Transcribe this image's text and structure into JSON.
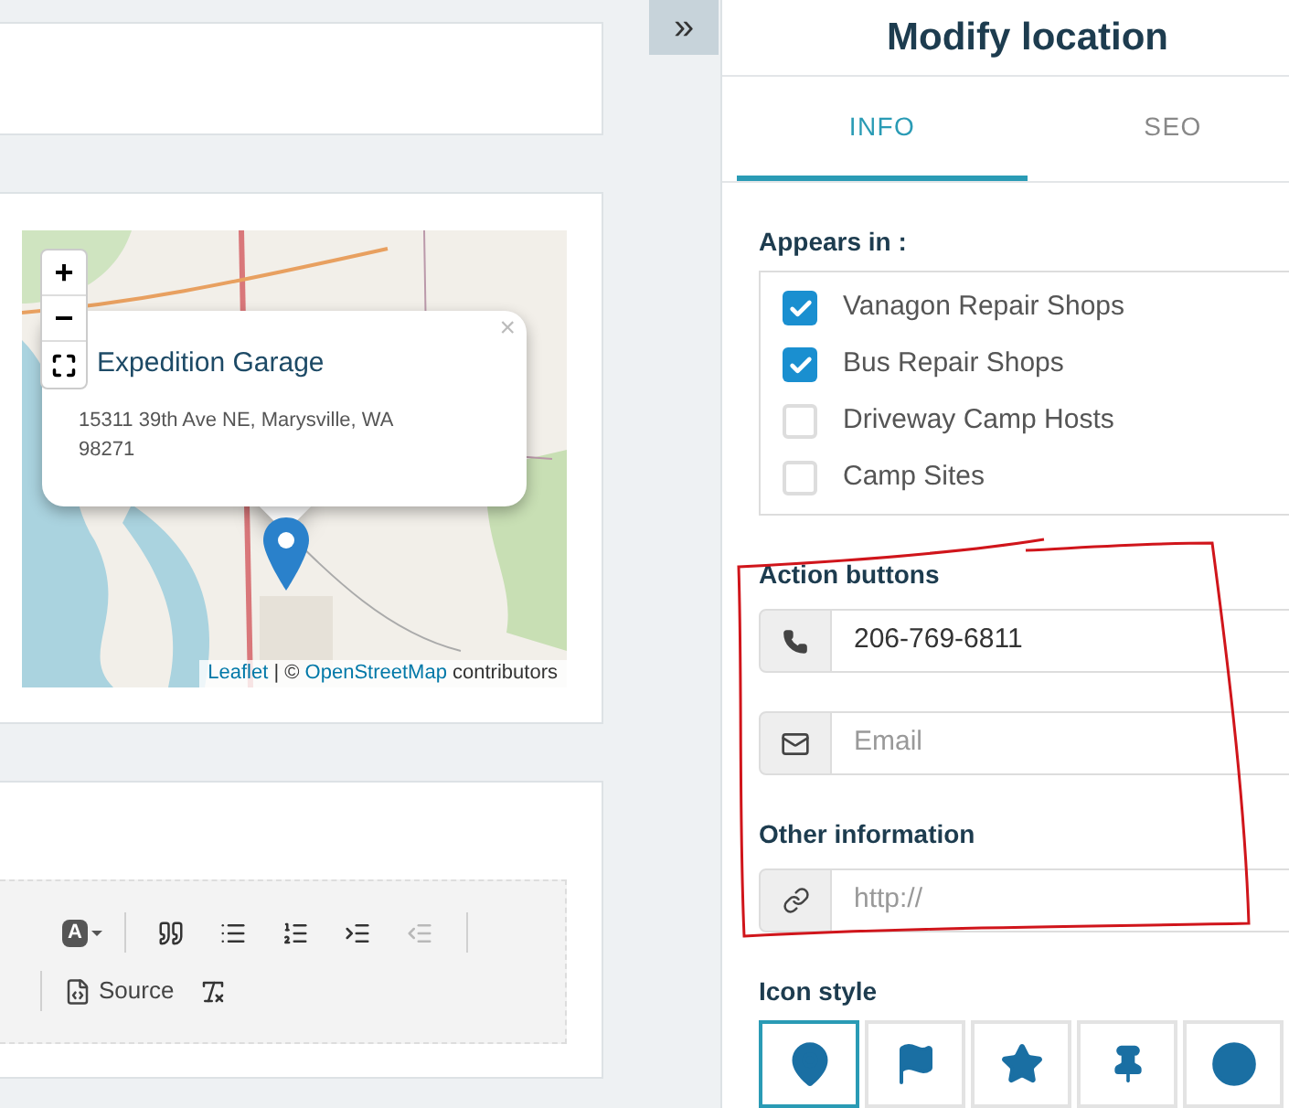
{
  "map": {
    "zoom_in": "+",
    "zoom_out": "−",
    "popup": {
      "title": "Expedition Garage",
      "address": "15311 39th Ave NE, Marysville, WA 98271",
      "close": "×"
    },
    "attribution": {
      "leaflet": "Leaflet",
      "separator": "| ©",
      "osm": "OpenStreetMap",
      "suffix": "contributors"
    }
  },
  "editor": {
    "rows": [
      [
        {
          "kind": "bg-color",
          "label": "A"
        },
        {
          "kind": "separator"
        },
        {
          "kind": "blockquote",
          "disabled": false
        },
        {
          "kind": "bulleted-list",
          "disabled": false
        },
        {
          "kind": "numbered-list",
          "disabled": false
        },
        {
          "kind": "indent",
          "disabled": false
        },
        {
          "kind": "outdent",
          "disabled": true
        },
        {
          "kind": "separator"
        }
      ],
      [
        {
          "kind": "separator"
        },
        {
          "kind": "source",
          "label": "Source"
        },
        {
          "kind": "remove-format",
          "disabled": false
        }
      ]
    ]
  },
  "panel": {
    "collapse": "»",
    "title": "Modify location",
    "tabs": [
      {
        "label": "INFO",
        "selected": true
      },
      {
        "label": "SEO",
        "selected": false
      }
    ],
    "appears_in": {
      "label": "Appears in :",
      "options": [
        {
          "label": "Vanagon Repair Shops",
          "checked": true
        },
        {
          "label": "Bus Repair Shops",
          "checked": true
        },
        {
          "label": "Driveway Camp Hosts",
          "checked": false
        },
        {
          "label": "Camp Sites",
          "checked": false
        }
      ]
    },
    "action_buttons": {
      "label": "Action buttons",
      "phone": {
        "value": "206-769-6811"
      },
      "email": {
        "placeholder": "Email"
      }
    },
    "other_information": {
      "label": "Other information",
      "url": {
        "placeholder": "http://"
      }
    },
    "icon_style": {
      "label": "Icon style",
      "options": [
        {
          "kind": "marker",
          "selected": true
        },
        {
          "kind": "flag",
          "selected": false
        },
        {
          "kind": "star",
          "selected": false
        },
        {
          "kind": "pin",
          "selected": false
        },
        {
          "kind": "circle",
          "selected": false
        }
      ]
    }
  }
}
